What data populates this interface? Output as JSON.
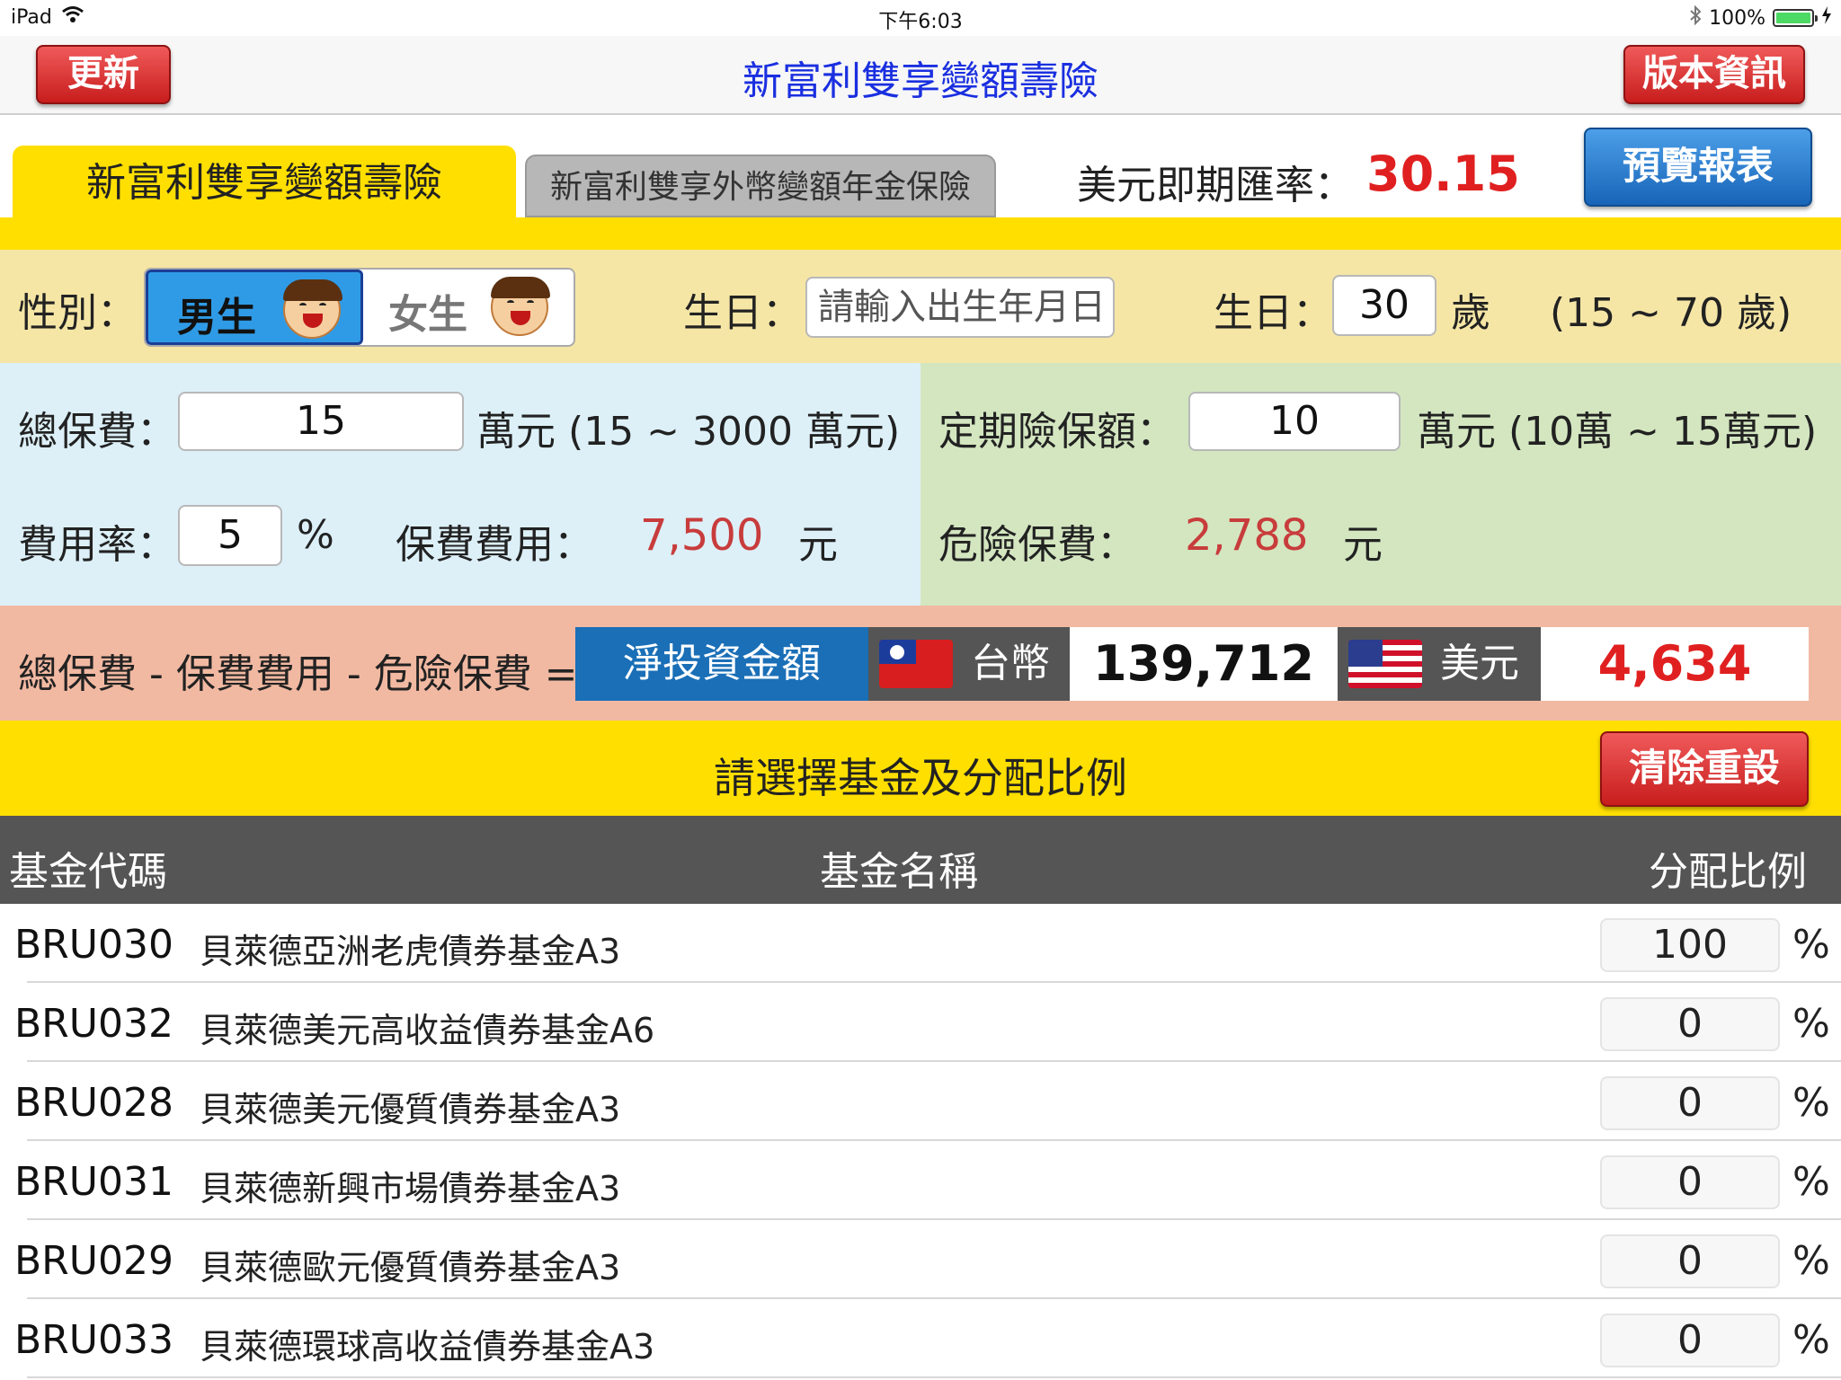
{
  "status_bar": {
    "device": "iPad",
    "time": "下午6:03",
    "battery": "100%"
  },
  "nav": {
    "refresh_label": "更新",
    "title": "新富利雙享變額壽險",
    "version_label": "版本資訊"
  },
  "tabs": [
    {
      "label": "新富利雙享變額壽險",
      "active": true
    },
    {
      "label": "新富利雙享外幣變額年金保險",
      "active": false
    }
  ],
  "exchange": {
    "label": "美元即期匯率：",
    "value": "30.15"
  },
  "preview_label": "預覽報表",
  "person": {
    "gender_label": "性別：",
    "male_label": "男生",
    "female_label": "女生",
    "selected_gender": "male",
    "birthday_label": "生日：",
    "birthday_placeholder": "請輸入出生年月日",
    "age_label": "生日：",
    "age_value": "30",
    "age_unit": "歲",
    "age_range": "(15 ~ 70 歲)"
  },
  "premium": {
    "total_label": "總保費：",
    "total_value": "15",
    "total_unit": "萬元 (15 ~ 3000 萬元)",
    "rate_label": "費用率：",
    "rate_value": "5",
    "rate_unit": "%",
    "fee_label": "保費費用：",
    "fee_value": "7,500",
    "fee_unit": "元"
  },
  "term": {
    "amount_label": "定期險保額：",
    "amount_value": "10",
    "amount_unit": "萬元 (10萬 ~ 15萬元)",
    "risk_label": "危險保費：",
    "risk_value": "2,788",
    "risk_unit": "元"
  },
  "formula": {
    "text": "總保費 - 保費費用 - 危險保費 =",
    "net_label": "淨投資金額",
    "twd_label": "台幣",
    "twd_value": "139,712",
    "usd_label": "美元",
    "usd_value": "4,634"
  },
  "funds": {
    "title": "請選擇基金及分配比例",
    "clear_label": "清除重設",
    "headers": {
      "code": "基金代碼",
      "name": "基金名稱",
      "alloc": "分配比例"
    },
    "rows": [
      {
        "code": "BRU030",
        "name": "貝萊德亞洲老虎債券基金A3",
        "alloc": "100",
        "unit": "%"
      },
      {
        "code": "BRU032",
        "name": "貝萊德美元高收益債券基金A6",
        "alloc": "0",
        "unit": "%"
      },
      {
        "code": "BRU028",
        "name": "貝萊德美元優質債券基金A3",
        "alloc": "0",
        "unit": "%"
      },
      {
        "code": "BRU031",
        "name": "貝萊德新興市場債券基金A3",
        "alloc": "0",
        "unit": "%"
      },
      {
        "code": "BRU029",
        "name": "貝萊德歐元優質債券基金A3",
        "alloc": "0",
        "unit": "%"
      },
      {
        "code": "BRU033",
        "name": "貝萊德環球高收益債券基金A3",
        "alloc": "0",
        "unit": "%"
      }
    ]
  },
  "colors": {
    "accent_yellow": "#ffdf00",
    "value_red": "#e02020",
    "title_blue": "#1a2fe0",
    "net_blue": "#1a6fb7"
  }
}
